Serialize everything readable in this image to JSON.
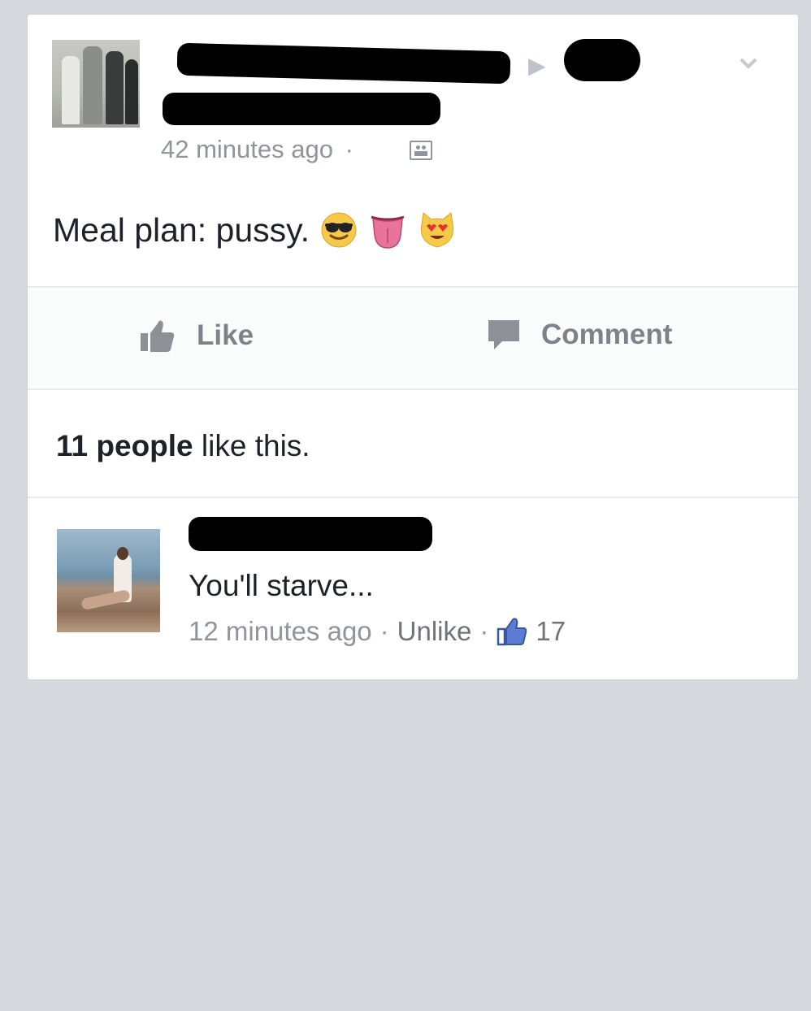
{
  "post": {
    "timestamp": "42 minutes ago",
    "separator": "·",
    "message": "Meal plan: pussy.",
    "emojis": [
      "smiling-face-with-sunglasses",
      "tongue",
      "smiling-cat-with-heart-eyes"
    ]
  },
  "actions": {
    "like_label": "Like",
    "comment_label": "Comment"
  },
  "likes": {
    "bold_part": "11 people",
    "rest": " like this."
  },
  "comment": {
    "text": "You'll starve...",
    "timestamp": "12 minutes ago",
    "separator": "·",
    "unlike_label": "Unlike",
    "like_count": "17"
  },
  "colors": {
    "background": "#d5d8dd",
    "card": "#ffffff",
    "muted_text": "#90949c",
    "like_blue": "#3b5998"
  }
}
